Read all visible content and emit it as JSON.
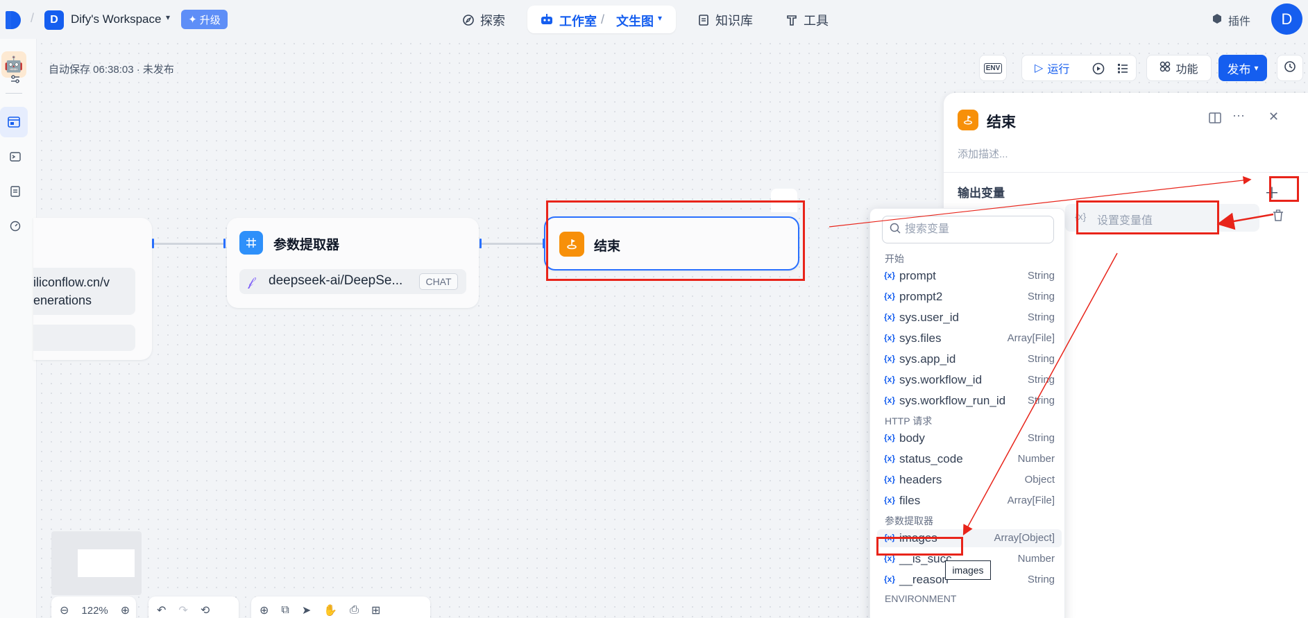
{
  "topbar": {
    "workspace_initial": "D",
    "workspace_name": "Dify's Workspace",
    "upgrade_label": "升级",
    "nav": [
      {
        "label": "探索"
      },
      {
        "label": "知识库"
      },
      {
        "label": "工具"
      }
    ],
    "studio_label": "工作室",
    "studio_sub": "文生图",
    "plugin_label": "插件",
    "avatar_initial": "D"
  },
  "status": {
    "autosave_text": "自动保存 06:38:03 · 未发布"
  },
  "toolbar": {
    "env_label": "ENV",
    "run_label": "运行",
    "features_label": "功能",
    "publish_label": "发布"
  },
  "nodes": {
    "http": {
      "line1": "iliconflow.cn/v",
      "line2": "enerations"
    },
    "param": {
      "title": "参数提取器",
      "model": "deepseek-ai/DeepSe...",
      "model_badge": "CHAT"
    },
    "end": {
      "title": "结束"
    }
  },
  "zoom": {
    "level": "122%"
  },
  "panel": {
    "title": "结束",
    "description_placeholder": "添加描述...",
    "output_label": "输出变量",
    "var_value_placeholder": "设置变量值"
  },
  "dropdown": {
    "search_placeholder": "搜索变量",
    "groups": [
      {
        "title": "开始",
        "items": [
          {
            "name": "prompt",
            "type": "String"
          },
          {
            "name": "prompt2",
            "type": "String"
          },
          {
            "name": "sys.user_id",
            "type": "String"
          },
          {
            "name": "sys.files",
            "type": "Array[File]"
          },
          {
            "name": "sys.app_id",
            "type": "String"
          },
          {
            "name": "sys.workflow_id",
            "type": "String"
          },
          {
            "name": "sys.workflow_run_id",
            "type": "String"
          }
        ]
      },
      {
        "title": "HTTP 请求",
        "items": [
          {
            "name": "body",
            "type": "String"
          },
          {
            "name": "status_code",
            "type": "Number"
          },
          {
            "name": "headers",
            "type": "Object"
          },
          {
            "name": "files",
            "type": "Array[File]"
          }
        ]
      },
      {
        "title": "参数提取器",
        "items": [
          {
            "name": "images",
            "type": "Array[Object]"
          },
          {
            "name": "__is_succ",
            "type": "Number"
          },
          {
            "name": "__reason",
            "type": "String"
          }
        ]
      },
      {
        "title": "ENVIRONMENT",
        "items": []
      }
    ],
    "tooltip": "images"
  },
  "icons": {
    "var_glyph": "{x}"
  }
}
